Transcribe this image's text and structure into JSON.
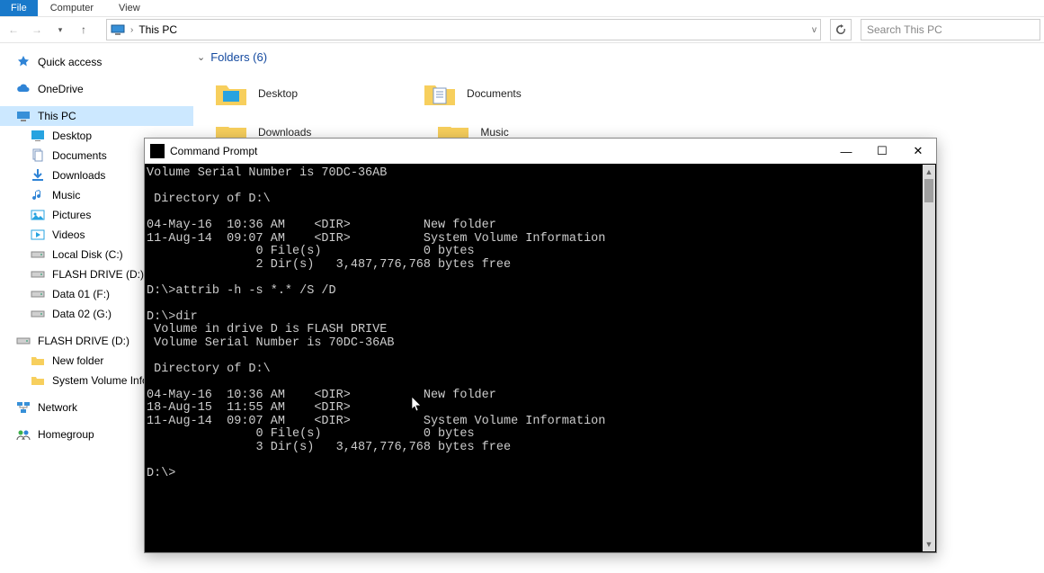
{
  "menubar": {
    "file": "File",
    "computer": "Computer",
    "view": "View"
  },
  "nav": {
    "breadcrumb": "This PC",
    "search_placeholder": "Search This PC"
  },
  "sidebar": {
    "quick_access": "Quick access",
    "onedrive": "OneDrive",
    "this_pc": "This PC",
    "desktop": "Desktop",
    "documents": "Documents",
    "downloads": "Downloads",
    "music": "Music",
    "pictures": "Pictures",
    "videos": "Videos",
    "local_c": "Local Disk (C:)",
    "flash_d": "FLASH DRIVE (D:)",
    "data01": "Data 01 (F:)",
    "data02": "Data 02 (G:)",
    "flash_d2": "FLASH DRIVE (D:)",
    "new_folder": "New folder",
    "svi": "System Volume Informatio",
    "network": "Network",
    "homegroup": "Homegroup"
  },
  "main": {
    "folders_header": "Folders (6)",
    "desktop": "Desktop",
    "documents": "Documents",
    "downloads": "Downloads",
    "music": "Music"
  },
  "cmd": {
    "title": "Command Prompt",
    "lines": "Volume Serial Number is 70DC-36AB\n\n Directory of D:\\\n\n04-May-16  10:36 AM    <DIR>          New folder\n11-Aug-14  09:07 AM    <DIR>          System Volume Information\n               0 File(s)              0 bytes\n               2 Dir(s)   3,487,776,768 bytes free\n\nD:\\>attrib -h -s *.* /S /D\n\nD:\\>dir\n Volume in drive D is FLASH DRIVE\n Volume Serial Number is 70DC-36AB\n\n Directory of D:\\\n\n04-May-16  10:36 AM    <DIR>          New folder\n18-Aug-15  11:55 AM    <DIR>\n11-Aug-14  09:07 AM    <DIR>          System Volume Information\n               0 File(s)              0 bytes\n               3 Dir(s)   3,487,776,768 bytes free\n\nD:\\>"
  }
}
